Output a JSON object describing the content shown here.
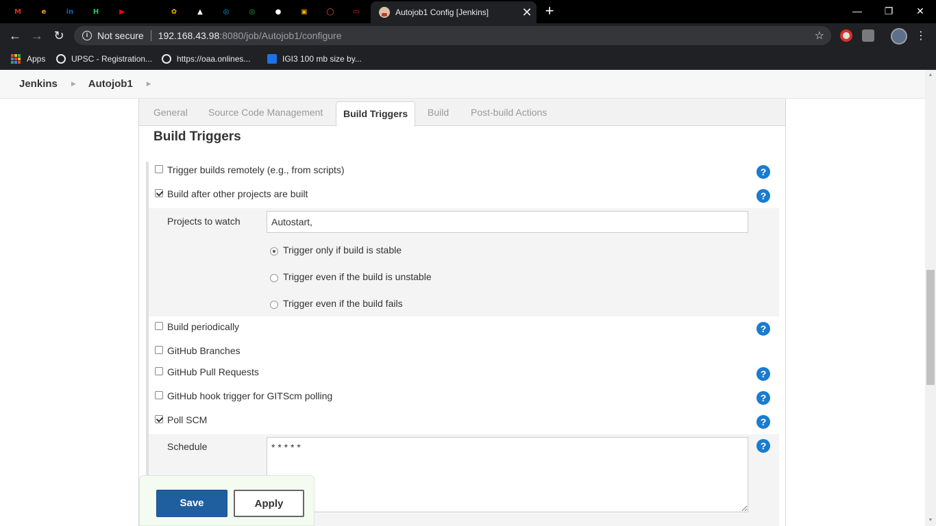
{
  "browser": {
    "tab_title": "Autojob1 Config [Jenkins]",
    "tab_close": "✕",
    "new_tab": "+",
    "security_label": "Not secure",
    "url_host": "192.168.43.98",
    "url_rest": ":8080/job/Autojob1/configure",
    "window_controls": {
      "minimize": "—",
      "restore": "❐",
      "close": "✕"
    },
    "pinned_tabs": [
      {
        "icon": "gmail-icon",
        "glyph": "M",
        "color": "#d93025"
      },
      {
        "icon": "edureka-icon",
        "glyph": "e",
        "color": "#f5a623"
      },
      {
        "icon": "linkedin-icon",
        "glyph": "in",
        "color": "#0a66c2"
      },
      {
        "icon": "hackerrank-icon",
        "glyph": "H",
        "color": "#2ec866"
      },
      {
        "icon": "youtube-icon",
        "glyph": "▶",
        "color": "#ff0000"
      },
      {
        "icon": "infinity-icon",
        "glyph": "∞",
        "color": "#000000"
      },
      {
        "icon": "flower-icon",
        "glyph": "✿",
        "color": "#f4b400"
      },
      {
        "icon": "bookmark-app-icon",
        "glyph": "▲",
        "color": "#ffffff"
      },
      {
        "icon": "ring-icon",
        "glyph": "◎",
        "color": "#00a4ef"
      },
      {
        "icon": "ring-green-icon",
        "glyph": "◎",
        "color": "#34a853"
      },
      {
        "icon": "github-icon",
        "glyph": "●",
        "color": "#ffffff"
      },
      {
        "icon": "slides-icon",
        "glyph": "▣",
        "color": "#f9ab00"
      },
      {
        "icon": "oracle-ring-icon",
        "glyph": "◯",
        "color": "#ff5722"
      },
      {
        "icon": "oracle-icon",
        "glyph": "▭",
        "color": "#e52b20"
      }
    ],
    "bookmarks": [
      {
        "label": "Apps",
        "icon": "apps-grid-icon"
      },
      {
        "label": "UPSC - Registration...",
        "icon": "globe-icon"
      },
      {
        "label": "https://oaa.onlines...",
        "icon": "globe-icon"
      },
      {
        "label": "IGI3 100 mb size by...",
        "icon": "blue-square-icon"
      }
    ]
  },
  "breadcrumb": [
    "Jenkins",
    "Autojob1"
  ],
  "config_tabs": [
    "General",
    "Source Code Management",
    "Build Triggers",
    "Build",
    "Post-build Actions"
  ],
  "active_tab": "Build Triggers",
  "section_title": "Build Triggers",
  "triggers": [
    {
      "label": "Trigger builds remotely (e.g., from scripts)",
      "checked": false
    },
    {
      "label": "Build after other projects are built",
      "checked": true
    },
    {
      "label": "Build periodically",
      "checked": false
    },
    {
      "label": "GitHub Branches",
      "checked": false
    },
    {
      "label": "GitHub Pull Requests",
      "checked": false
    },
    {
      "label": "GitHub hook trigger for GITScm polling",
      "checked": false
    },
    {
      "label": "Poll SCM",
      "checked": true
    }
  ],
  "projects_to_watch": {
    "label": "Projects to watch",
    "value": "Autostart,"
  },
  "radio_options": [
    {
      "label": "Trigger only if build is stable",
      "checked": true
    },
    {
      "label": "Trigger even if the build is unstable",
      "checked": false
    },
    {
      "label": "Trigger even if the build fails",
      "checked": false
    }
  ],
  "schedule": {
    "label": "Schedule",
    "value": "* * * * *"
  },
  "help_glyph": "?",
  "buttons": {
    "save": "Save",
    "apply": "Apply"
  },
  "colors": {
    "save_button": "#1f5fa0",
    "help_icon": "#1a7ccf",
    "bottom_bar": "#f4fbf1"
  }
}
